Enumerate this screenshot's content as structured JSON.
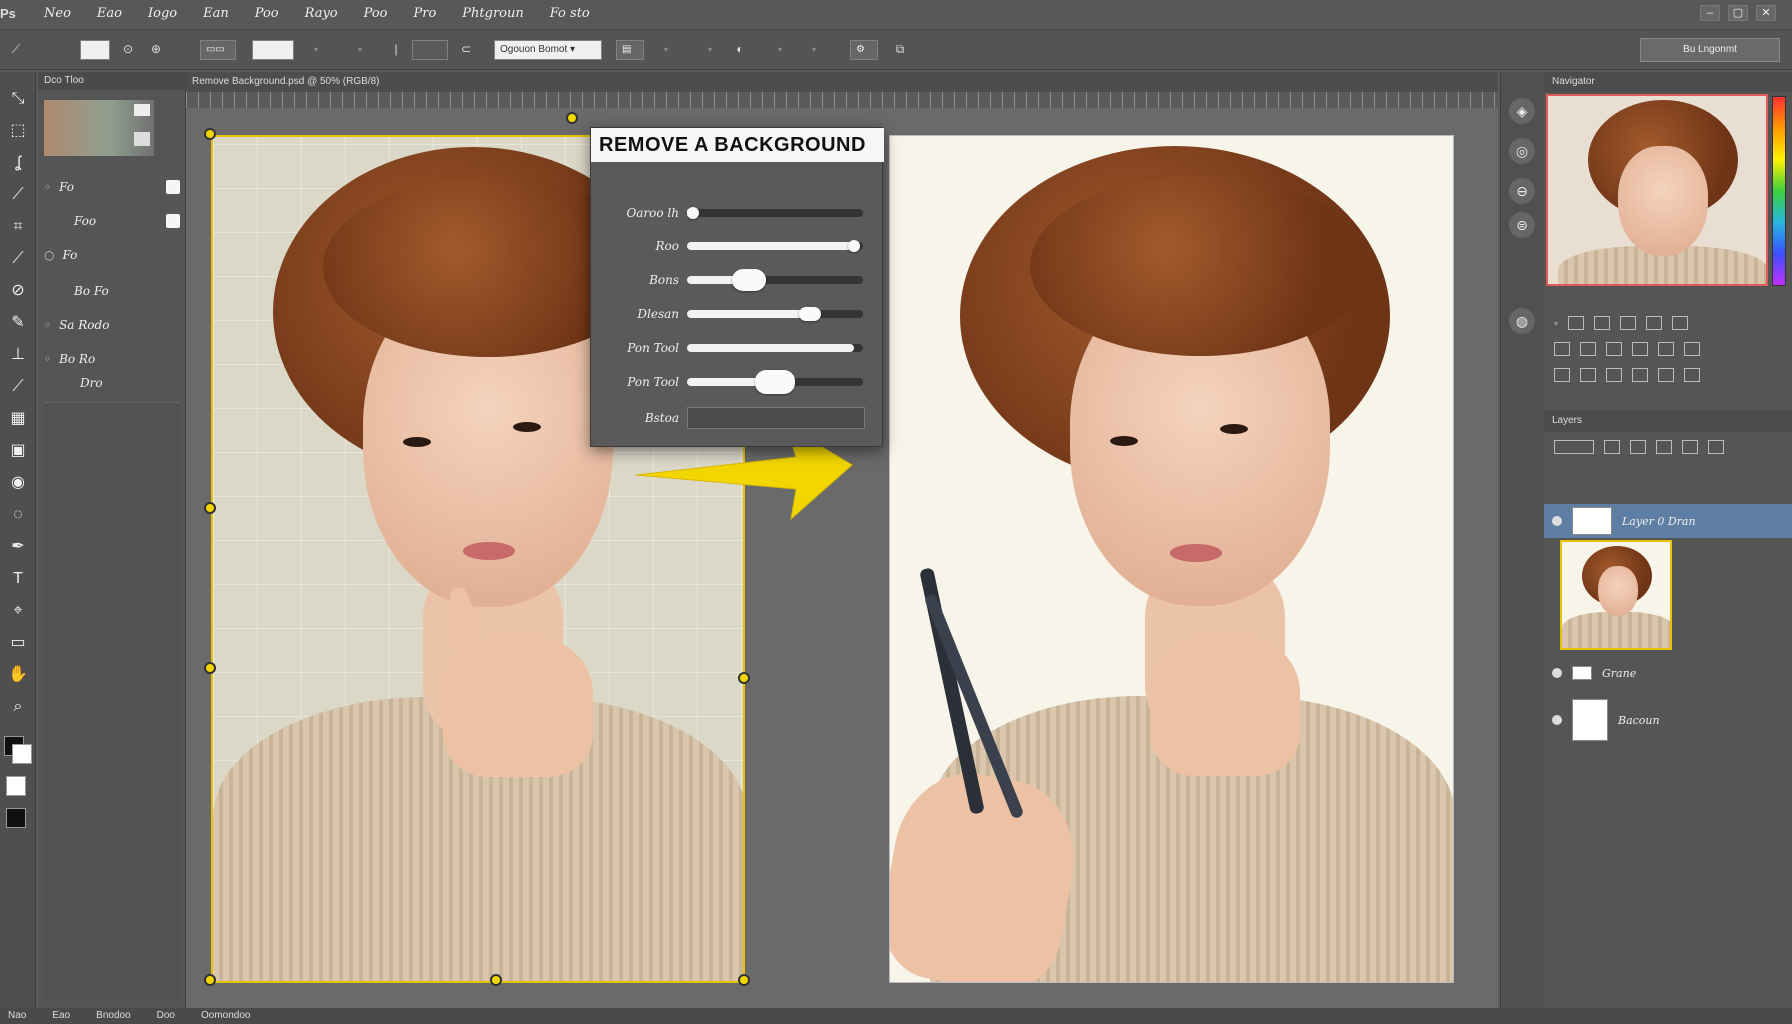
{
  "menubar": {
    "logo": "Ps",
    "items": [
      "Neo",
      "Eao",
      "Iogo",
      "Ean",
      "Poo",
      "Rayo",
      "Poo",
      "Pro",
      "Phtgroun",
      "Fo sto"
    ]
  },
  "optionsbar": {
    "dropdown_label": "Ogouon  Bomot",
    "workspace_label": "Bu Lngonmt"
  },
  "leftpanel": {
    "title": "Dco Tloo",
    "rows": [
      "Fo",
      "Foo",
      "Fo",
      "Bo Fo",
      "Sa Rodo",
      "Bo Ro",
      "Dro"
    ]
  },
  "document": {
    "tab_label": "Remove Background.psd @ 50% (RGB/8)"
  },
  "dialog": {
    "title": "REMOVE A BACKGROUND",
    "rows": [
      {
        "label": "Oaroo lh",
        "value": 0.02
      },
      {
        "label": "Roo",
        "value": 0.95
      },
      {
        "label": "Bons",
        "value": 0.35
      },
      {
        "label": "Dlesan",
        "value": 0.7
      },
      {
        "label": "Pon Tool",
        "value": 0.95
      },
      {
        "label": "Pon Tool",
        "value": 0.5
      }
    ],
    "footer_label": "Bstoa"
  },
  "rightpanel": {
    "nav_title": "Navigator",
    "layers_title": "Layers",
    "layer_rows": [
      {
        "name": "Layer 0 Dran",
        "selected": true
      },
      {
        "name": "Grane",
        "selected": false
      },
      {
        "name": "Bacoun",
        "selected": false
      }
    ]
  },
  "statusbar": {
    "items": [
      "Nao",
      "Eao",
      "Bnodoo",
      "Doo",
      "Oomondoo"
    ]
  },
  "colors": {
    "accent": "#e5c300",
    "selection": "#5e7ea3",
    "arrow": "#f2d600"
  }
}
